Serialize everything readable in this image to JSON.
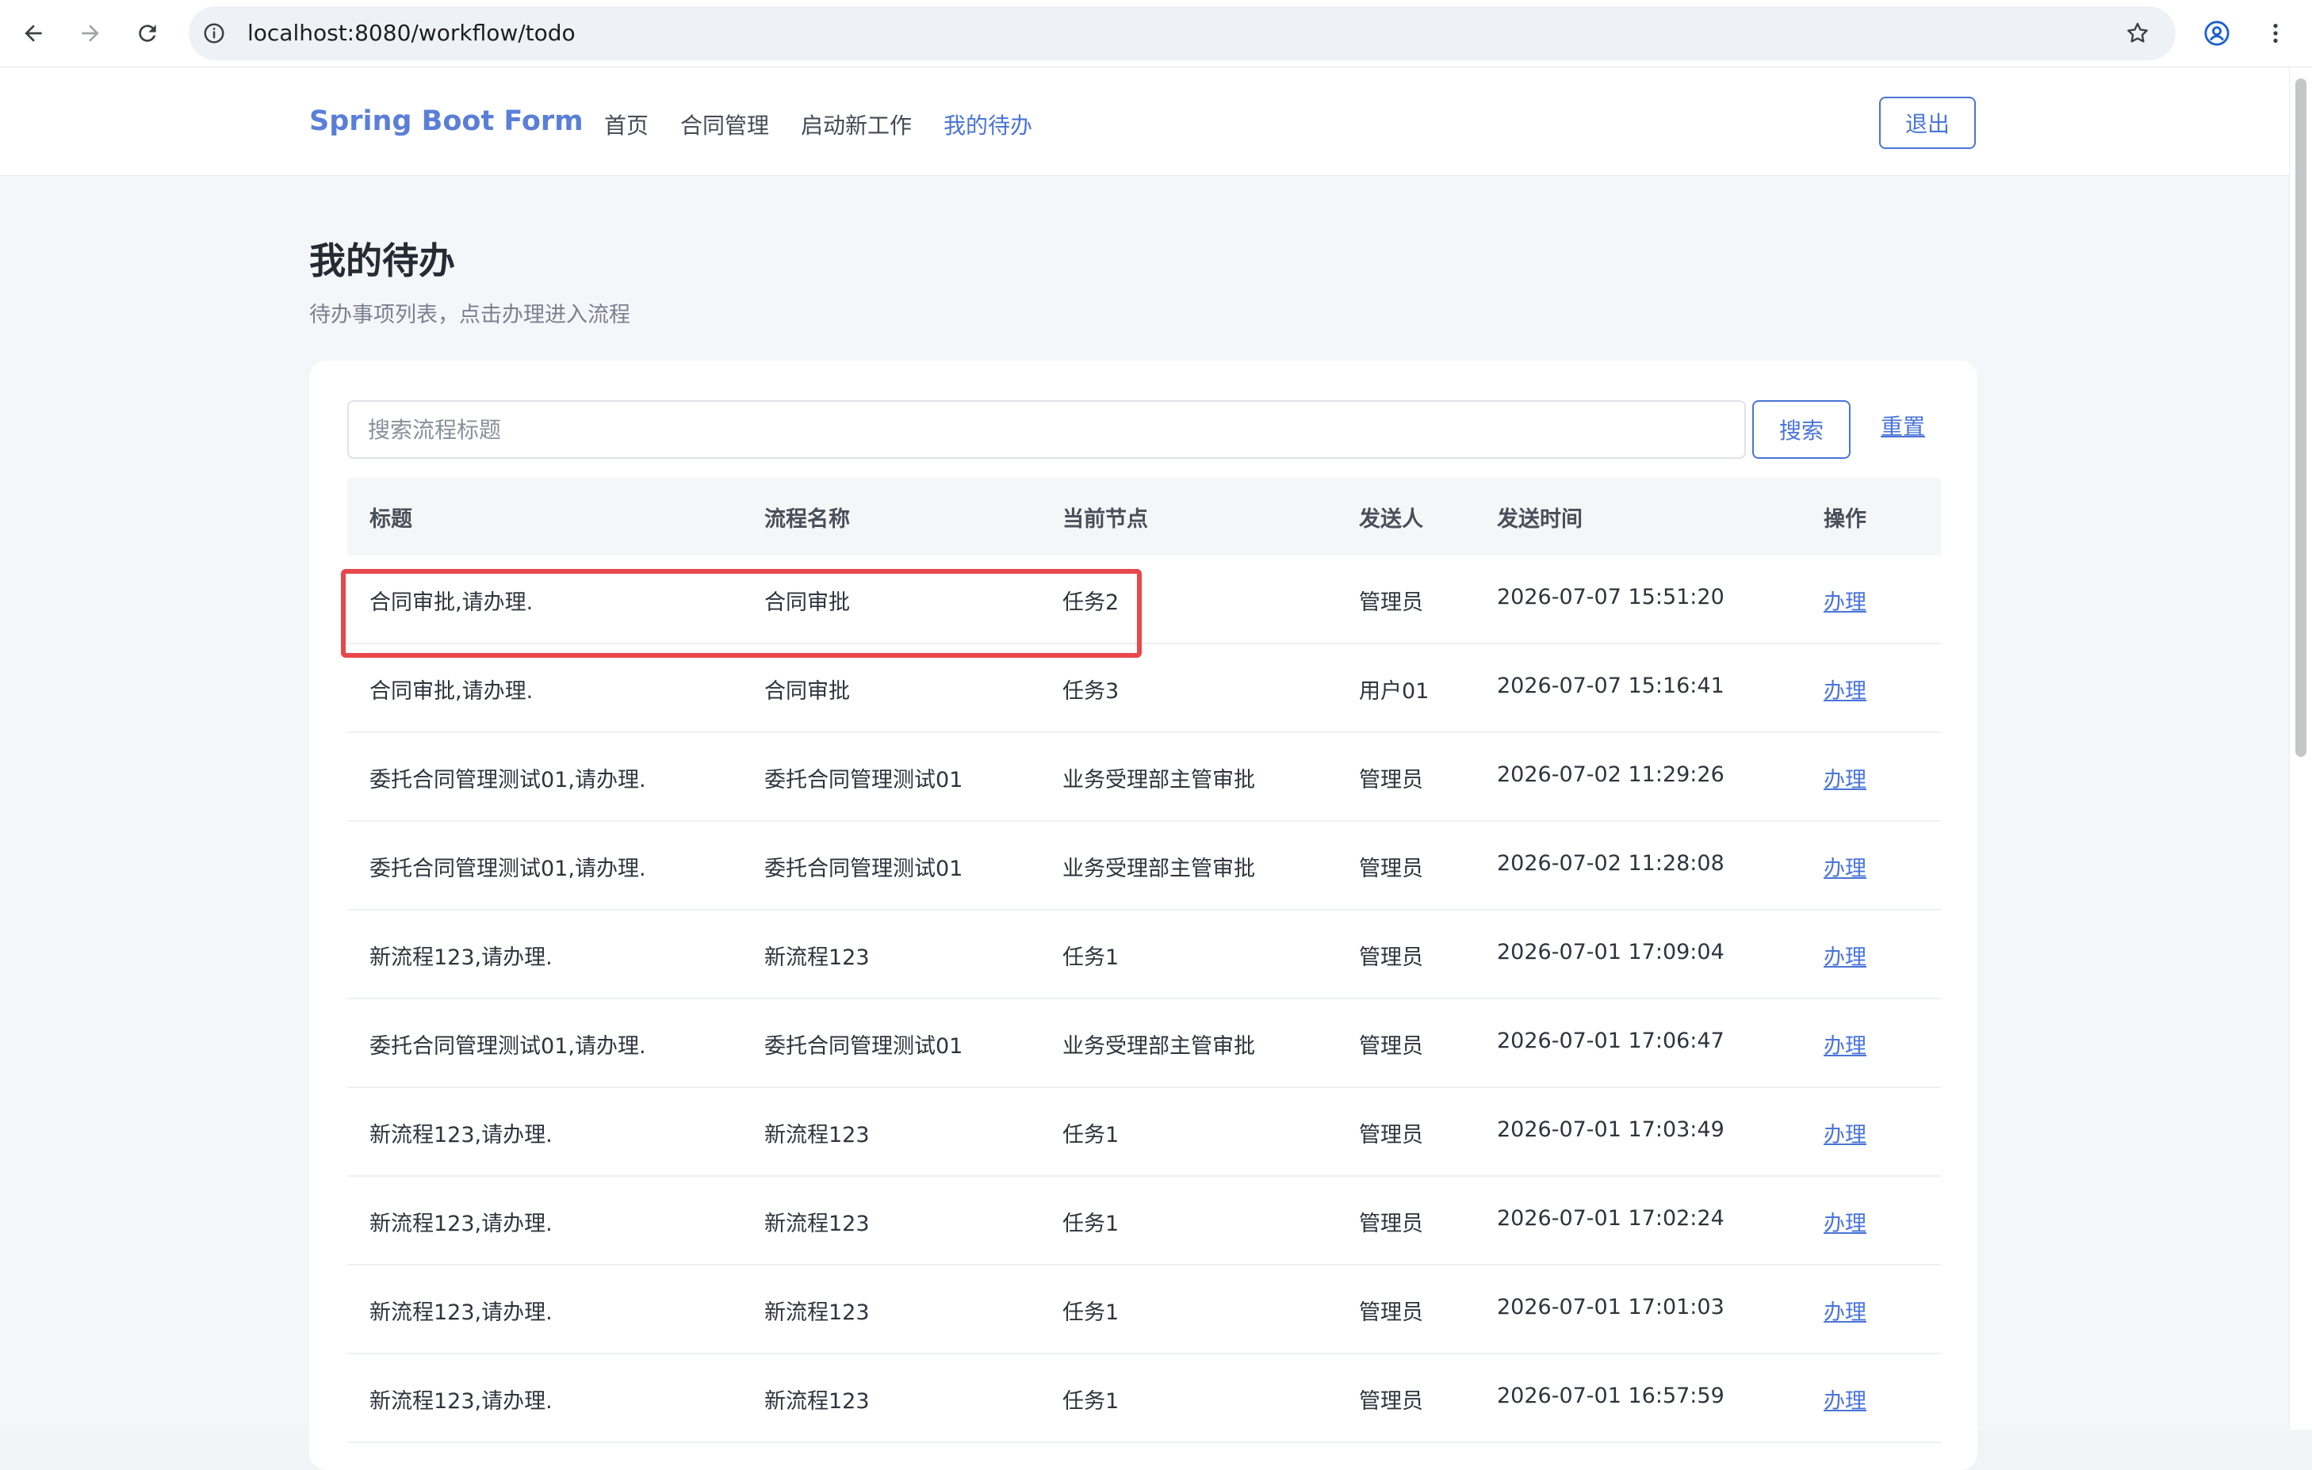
{
  "browser": {
    "url": "localhost:8080/workflow/todo"
  },
  "header": {
    "brand": "Spring Boot Form",
    "menu": [
      "首页",
      "合同管理",
      "启动新工作",
      "我的待办"
    ],
    "active_index": 3,
    "logout_label": "退出"
  },
  "main": {
    "title": "我的待办",
    "subtitle": "待办事项列表，点击办理进入流程",
    "search": {
      "placeholder": "搜索流程标题",
      "value": "",
      "button_label": "搜索",
      "reset_label": "重置"
    },
    "table": {
      "columns": [
        "标题",
        "流程名称",
        "当前节点",
        "发送人",
        "发送时间",
        "操作"
      ],
      "highlighted_row": 0,
      "rows": [
        {
          "title": "合同审批,请办理.",
          "process": "合同审批",
          "node": "任务2",
          "sender": "管理员",
          "time": "2026-07-07 15:51:20",
          "action": "办理"
        },
        {
          "title": "合同审批,请办理.",
          "process": "合同审批",
          "node": "任务3",
          "sender": "用户01",
          "time": "2026-07-07 15:16:41",
          "action": "办理"
        },
        {
          "title": "委托合同管理测试01,请办理.",
          "process": "委托合同管理测试01",
          "node": "业务受理部主管审批",
          "sender": "管理员",
          "time": "2026-07-02 11:29:26",
          "action": "办理"
        },
        {
          "title": "委托合同管理测试01,请办理.",
          "process": "委托合同管理测试01",
          "node": "业务受理部主管审批",
          "sender": "管理员",
          "time": "2026-07-02 11:28:08",
          "action": "办理"
        },
        {
          "title": "新流程123,请办理.",
          "process": "新流程123",
          "node": "任务1",
          "sender": "管理员",
          "time": "2026-07-01 17:09:04",
          "action": "办理"
        },
        {
          "title": "委托合同管理测试01,请办理.",
          "process": "委托合同管理测试01",
          "node": "业务受理部主管审批",
          "sender": "管理员",
          "time": "2026-07-01 17:06:47",
          "action": "办理"
        },
        {
          "title": "新流程123,请办理.",
          "process": "新流程123",
          "node": "任务1",
          "sender": "管理员",
          "time": "2026-07-01 17:03:49",
          "action": "办理"
        },
        {
          "title": "新流程123,请办理.",
          "process": "新流程123",
          "node": "任务1",
          "sender": "管理员",
          "time": "2026-07-01 17:02:24",
          "action": "办理"
        },
        {
          "title": "新流程123,请办理.",
          "process": "新流程123",
          "node": "任务1",
          "sender": "管理员",
          "time": "2026-07-01 17:01:03",
          "action": "办理"
        },
        {
          "title": "新流程123,请办理.",
          "process": "新流程123",
          "node": "任务1",
          "sender": "管理员",
          "time": "2026-07-01 16:57:59",
          "action": "办理"
        }
      ]
    }
  },
  "colors": {
    "accent": "#4a74d8",
    "brand": "#5b7fd8",
    "highlight": "#e8474b"
  }
}
